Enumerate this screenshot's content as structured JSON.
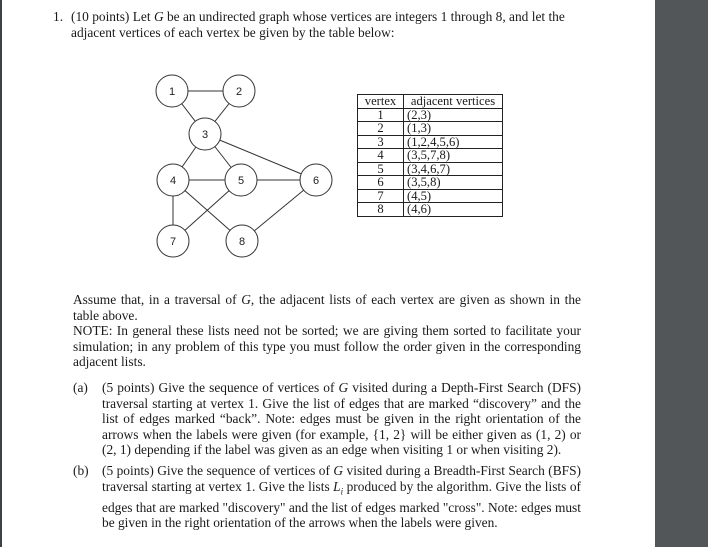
{
  "question": {
    "number": "1.",
    "intro_line1": "(10 points) Let G be an undirected graph whose vertices are integers 1 through 8, and let the",
    "intro_line1_parts": {
      "pre": "(10 points) Let ",
      "var": "G",
      "post": " be an undirected graph whose vertices are integers 1 through 8, and let the"
    },
    "intro_line2": "adjacent vertices of each vertex be given by the table below:"
  },
  "graph": {
    "nodes": [
      {
        "id": "1",
        "label": "1"
      },
      {
        "id": "2",
        "label": "2"
      },
      {
        "id": "3",
        "label": "3"
      },
      {
        "id": "4",
        "label": "4"
      },
      {
        "id": "5",
        "label": "5"
      },
      {
        "id": "6",
        "label": "6"
      },
      {
        "id": "7",
        "label": "7"
      },
      {
        "id": "8",
        "label": "8"
      }
    ],
    "edges": [
      [
        "1",
        "2"
      ],
      [
        "1",
        "3"
      ],
      [
        "2",
        "3"
      ],
      [
        "3",
        "4"
      ],
      [
        "3",
        "5"
      ],
      [
        "3",
        "6"
      ],
      [
        "4",
        "5"
      ],
      [
        "5",
        "6"
      ],
      [
        "4",
        "7"
      ],
      [
        "4",
        "8"
      ],
      [
        "5",
        "7"
      ],
      [
        "6",
        "8"
      ]
    ]
  },
  "table": {
    "headers": [
      "vertex",
      "adjacent vertices"
    ],
    "rows": [
      {
        "vertex": "1",
        "adjacent": "(2,3)"
      },
      {
        "vertex": "2",
        "adjacent": "(1,3)"
      },
      {
        "vertex": "3",
        "adjacent": "(1,2,4,5,6)"
      },
      {
        "vertex": "4",
        "adjacent": "(3,5,7,8)"
      },
      {
        "vertex": "5",
        "adjacent": "(3,4,6,7)"
      },
      {
        "vertex": "6",
        "adjacent": "(3,5,8)"
      },
      {
        "vertex": "7",
        "adjacent": "(4,5)"
      },
      {
        "vertex": "8",
        "adjacent": "(4,6)"
      }
    ]
  },
  "assumption": {
    "pre": "Assume that, in a traversal of ",
    "var": "G",
    "post": ", the adjacent lists of each vertex are given as shown in the table above."
  },
  "note": "NOTE: In general these lists need not be sorted; we are giving them sorted to facilitate your simulation; in any problem of this type you must follow the order given in the corresponding adjacent lists.",
  "parts": {
    "a": {
      "label": "(a)",
      "pre": "(5 points) Give the sequence of vertices of ",
      "var": "G",
      "post": " visited during a Depth-First Search (DFS) traversal starting at vertex 1. Give the list of edges that are marked “discovery” and the list of edges marked “back”. Note: edges must be given in the right orientation of the arrows when the labels were given (for example, {1, 2} will be either given as (1, 2) or (2, 1) depending if the label was given as an edge when visiting 1 or when visiting 2)."
    },
    "b": {
      "label": "(b)",
      "pre": "(5 points) Give the sequence of vertices of ",
      "var": "G",
      "mid": " visited during a Breadth-First Search (BFS) traversal starting at vertex 1. Give the lists ",
      "var2": "L",
      "sub": "i",
      "post": " produced by the algorithm. Give the lists of edges that are marked \"discovery\" and the list of edges marked \"cross\". Note: edges must be given in the right orientation of the arrows when the labels were given."
    }
  }
}
